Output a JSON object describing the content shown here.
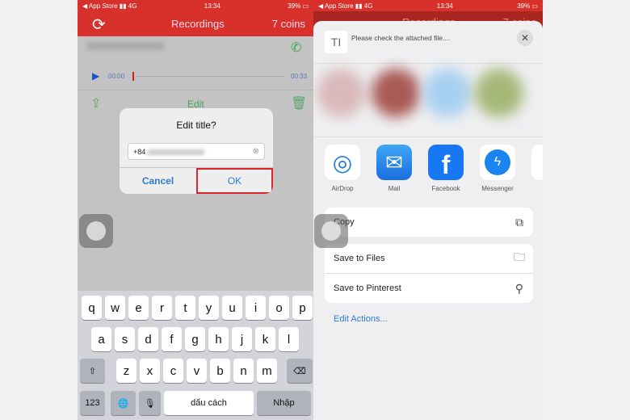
{
  "status": {
    "carrier": "◀ App Store",
    "network": "4G",
    "time": "13:34",
    "battery": "39%"
  },
  "left": {
    "header": {
      "title": "Recordings",
      "coins": "7 coins"
    },
    "player": {
      "start": "00:00",
      "end": "00:33"
    },
    "toolbar": {
      "edit": "Edit"
    },
    "dialog": {
      "title": "Edit title?",
      "value": "+84",
      "cancel": "Cancel",
      "ok": "OK"
    },
    "keyboard": {
      "row1": [
        "q",
        "w",
        "e",
        "r",
        "t",
        "y",
        "u",
        "i",
        "o",
        "p"
      ],
      "row2": [
        "a",
        "s",
        "d",
        "f",
        "g",
        "h",
        "j",
        "k",
        "l"
      ],
      "row3": [
        "z",
        "x",
        "c",
        "v",
        "b",
        "n",
        "m"
      ],
      "num": "123",
      "space": "dấu cách",
      "enter": "Nhập"
    }
  },
  "right": {
    "header": {
      "title": "Recordings",
      "coins": "7 coins"
    },
    "share": {
      "message": "Please check the attached file....",
      "apps": [
        {
          "label": "AirDrop"
        },
        {
          "label": "Mail"
        },
        {
          "label": "Facebook"
        },
        {
          "label": "Messenger"
        }
      ],
      "actions": {
        "copy": "Copy",
        "files": "Save to Files",
        "pinterest": "Save to Pinterest",
        "edit": "Edit Actions..."
      }
    }
  },
  "colors": {
    "brand_red": "#d8302a",
    "ios_blue": "#2f7ad1",
    "highlight": "#e0232a"
  }
}
